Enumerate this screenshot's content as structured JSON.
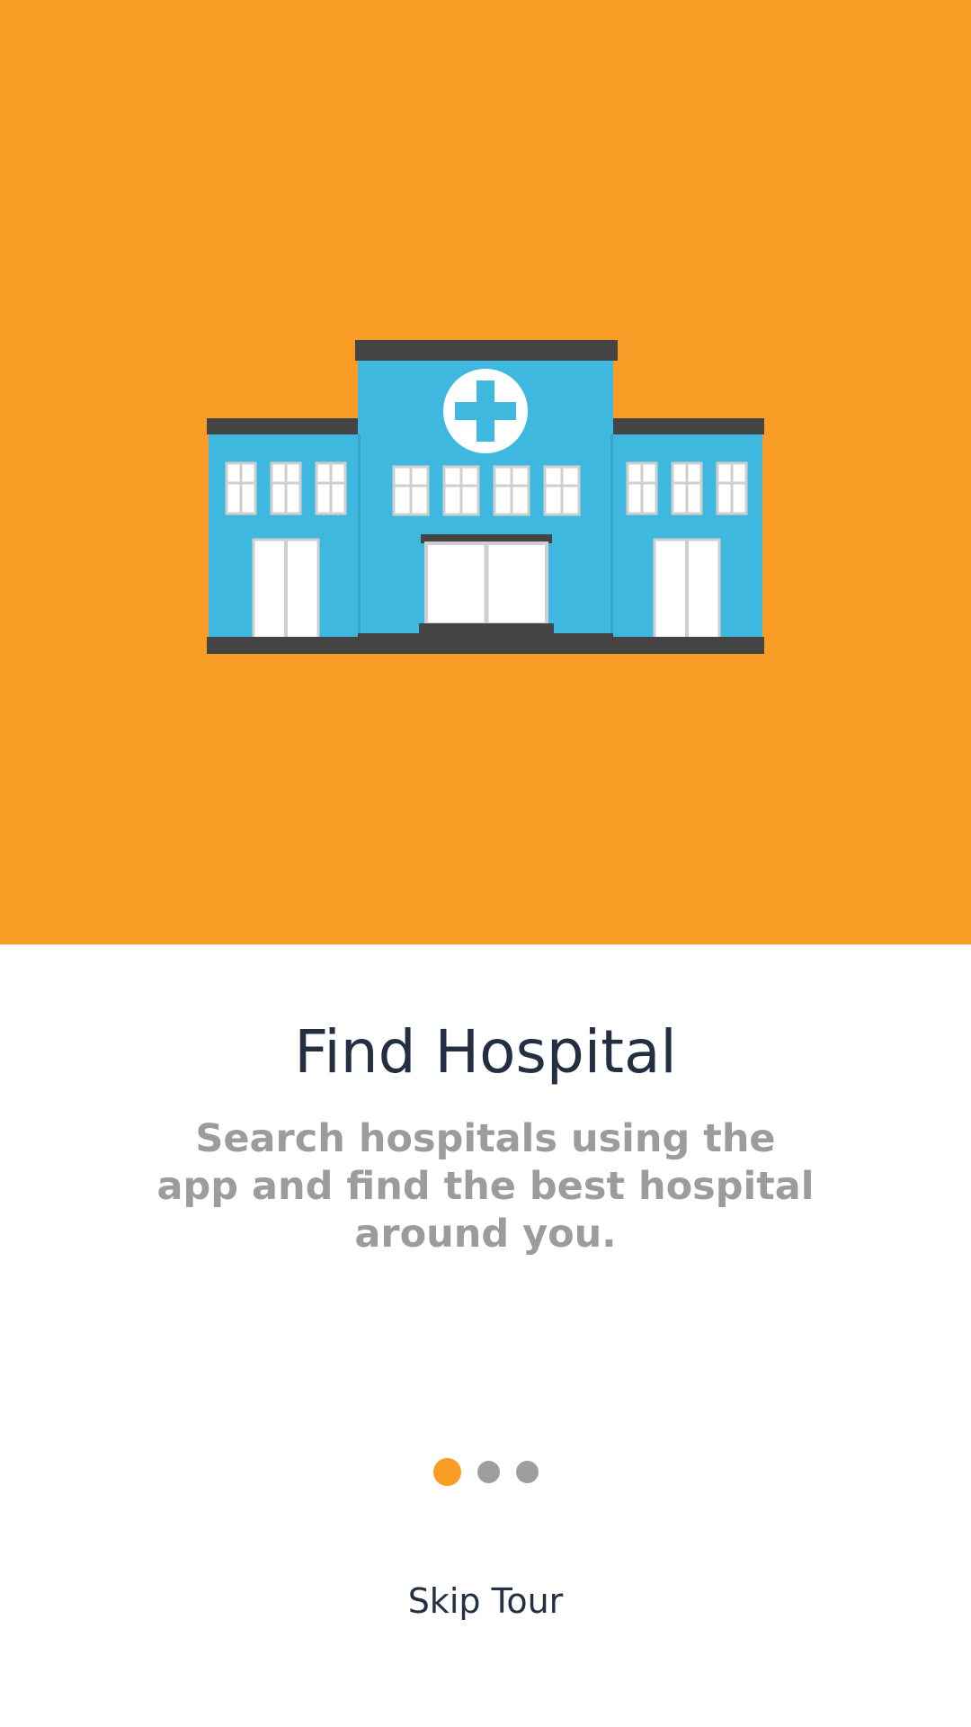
{
  "onboarding": {
    "title": "Find Hospital",
    "description": "Search hospitals using the app and find the best hospital around you.",
    "skip_label": "Skip Tour",
    "pages_total": 3,
    "active_page": 1
  },
  "illustration": {
    "icon": "hospital-building-icon",
    "background_color": "#F99C26",
    "building_color": "#3EB8DE",
    "roof_color": "#444444"
  },
  "colors": {
    "accent": "#F99C26",
    "title_text": "#243042",
    "description_text": "#9C9C9C",
    "dot_inactive": "#9E9E9E"
  }
}
